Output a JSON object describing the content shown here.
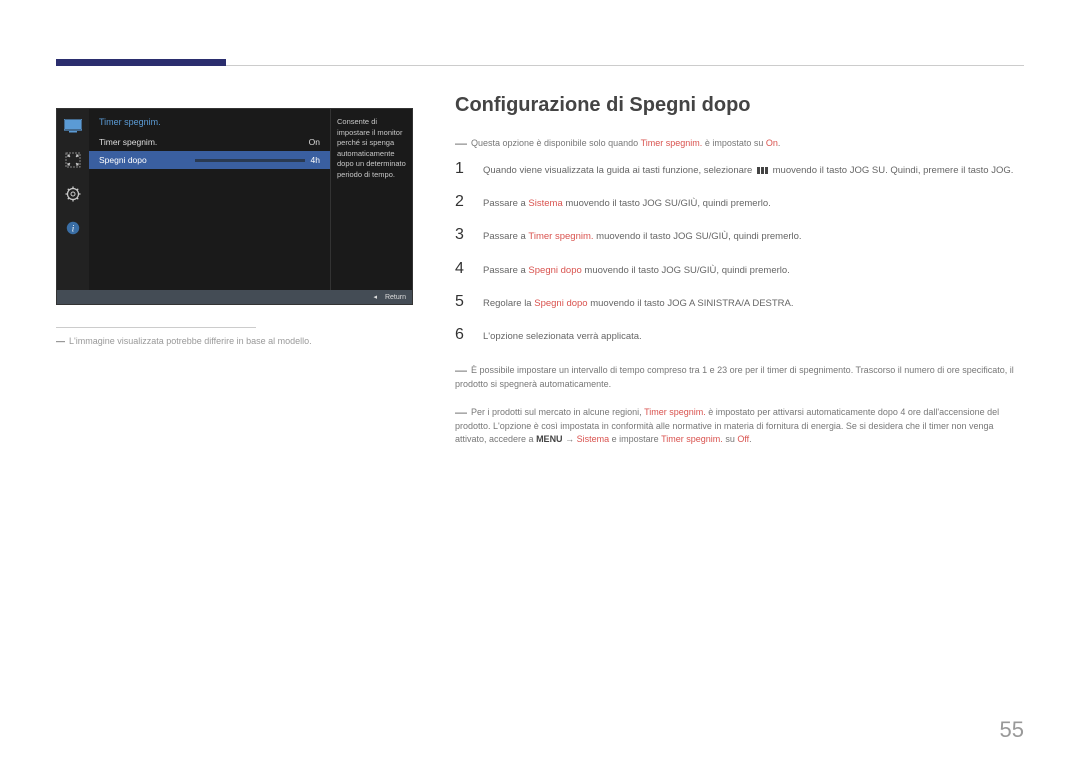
{
  "osd": {
    "title": "Timer spegnim.",
    "rows": [
      {
        "label": "Timer spegnim.",
        "value": "On"
      },
      {
        "label": "Spegni dopo",
        "value": "4h"
      }
    ],
    "description": "Consente di impostare il monitor perché si spenga automaticamente dopo un determinato periodo di tempo.",
    "footer_return": "Return",
    "footer_arrow": "◂"
  },
  "caption": "L'immagine visualizzata potrebbe differire in base al modello.",
  "heading": "Configurazione di Spegni dopo",
  "intro_note_pre": "Questa opzione è disponibile solo quando ",
  "intro_note_hl1": "Timer spegnim.",
  "intro_note_mid": " è impostato su ",
  "intro_note_hl2": "On",
  "intro_note_post": ".",
  "steps": {
    "s1a": "Quando viene visualizzata la guida ai tasti funzione, selezionare ",
    "s1b": " muovendo il tasto JOG SU. Quindi, premere il tasto JOG.",
    "s2a": "Passare a ",
    "s2hl": "Sistema",
    "s2b": " muovendo il tasto JOG SU/GIÙ, quindi premerlo.",
    "s3a": "Passare a ",
    "s3hl": "Timer spegnim.",
    "s3b": " muovendo il tasto JOG SU/GIÙ, quindi premerlo.",
    "s4a": "Passare a ",
    "s4hl": "Spegni dopo",
    "s4b": " muovendo il tasto JOG SU/GIÙ, quindi premerlo.",
    "s5a": "Regolare la ",
    "s5hl": "Spegni dopo",
    "s5b": " muovendo il tasto JOG A SINISTRA/A DESTRA.",
    "s6": "L'opzione selezionata verrà applicata."
  },
  "foot1": "È possibile impostare un intervallo di tempo compreso tra 1 e 23 ore per il timer di spegnimento. Trascorso il numero di ore specificato, il prodotto si spegnerà automaticamente.",
  "foot2a": "Per i prodotti sul mercato in alcune regioni, ",
  "foot2hl1": "Timer spegnim.",
  "foot2b": " è impostato per attivarsi automaticamente dopo 4 ore dall'accensione del prodotto. L'opzione è così impostata in conformità alle normative in materia di fornitura di energia. Se si desidera che il timer non venga attivato, accedere a ",
  "foot2hlMenu": "MENU",
  "foot2arrow": " → ",
  "foot2hlSys": "Sistema",
  "foot2c": " e impostare ",
  "foot2hl2": "Timer spegnim.",
  "foot2d": " su ",
  "foot2hlOff": "Off",
  "foot2e": ".",
  "page": "55"
}
